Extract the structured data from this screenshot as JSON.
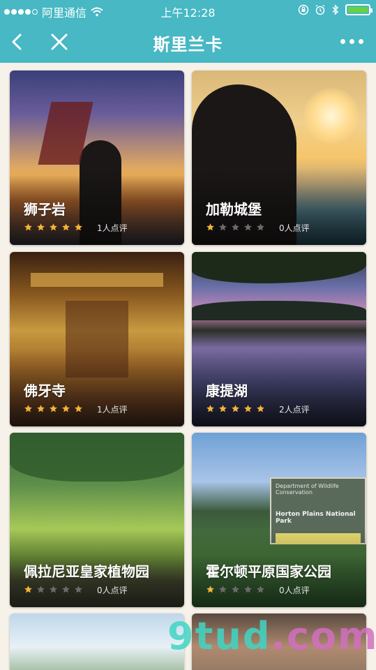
{
  "status_bar": {
    "carrier": "阿里通信",
    "time": "上午12:28",
    "battery_color": "#69d23f"
  },
  "nav": {
    "title": "斯里兰卡",
    "back_icon": "chevron-left-icon",
    "close_icon": "close-icon",
    "more_icon": "more-horizontal-icon",
    "bar_color": "#47b8c4"
  },
  "cards": [
    {
      "title": "狮子岩",
      "rating": 5,
      "reviews": "1人点评"
    },
    {
      "title": "加勒城堡",
      "rating": 1,
      "reviews": "0人点评"
    },
    {
      "title": "佛牙寺",
      "rating": 5,
      "reviews": "1人点评"
    },
    {
      "title": "康提湖",
      "rating": 5,
      "reviews": "2人点评"
    },
    {
      "title": "佩拉尼亚皇家植物园",
      "rating": 1,
      "reviews": "0人点评"
    },
    {
      "title": "霍尔顿平原国家公园",
      "rating": 1,
      "reviews": "0人点评"
    }
  ],
  "sign": {
    "line1": "Department of Wildlife Conservation",
    "line2": "Horton Plains National Park"
  },
  "watermark": {
    "text": "9tud",
    "suffix": ".com"
  },
  "colors": {
    "star_filled": "#f4b33a",
    "star_empty": "#6b6b6b"
  }
}
